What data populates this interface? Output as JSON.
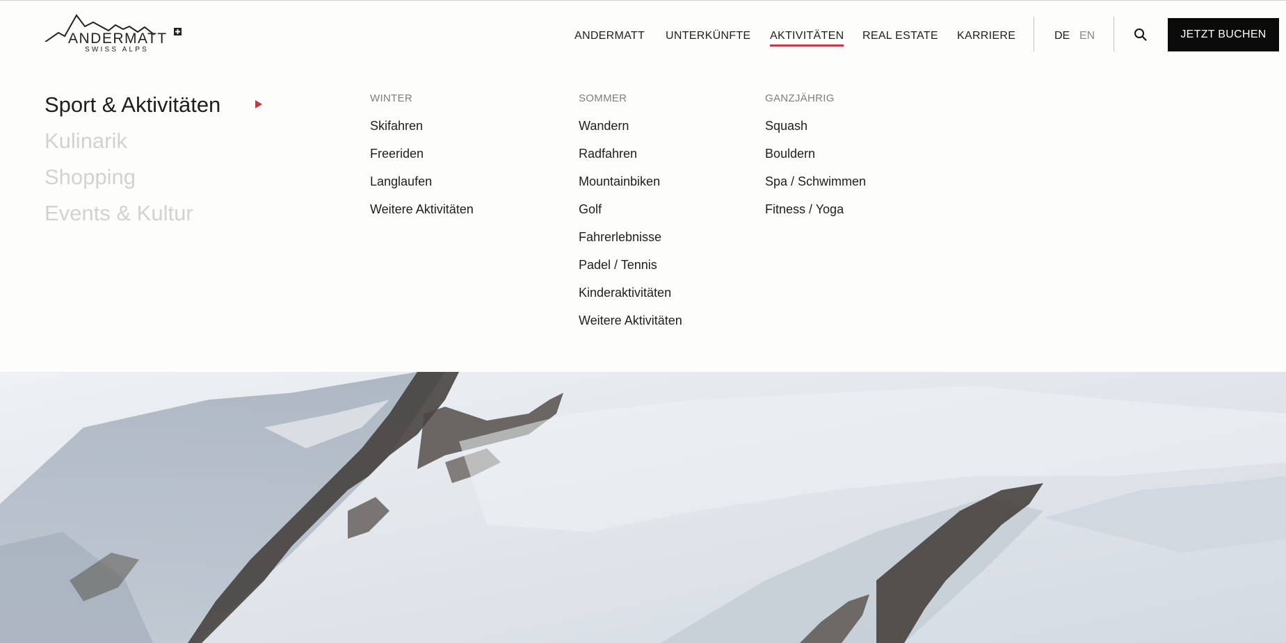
{
  "brand": {
    "name": "ANDERMATT",
    "subtitle": "SWISS ALPS"
  },
  "nav": {
    "items": [
      {
        "label": "ANDERMATT",
        "active": false
      },
      {
        "label": "UNTERKÜNFTE",
        "active": false
      },
      {
        "label": "AKTIVITÄTEN",
        "active": true
      },
      {
        "label": "REAL ESTATE",
        "active": false
      },
      {
        "label": "KARRIERE",
        "active": false
      }
    ],
    "accent_color": "#c8353b"
  },
  "languages": {
    "de": "DE",
    "en": "EN",
    "selected": "DE"
  },
  "search": {
    "icon": "search-icon"
  },
  "cta": {
    "label": "JETZT BUCHEN"
  },
  "megamenu": {
    "categories": [
      {
        "label": "Sport & Aktivitäten",
        "active": true
      },
      {
        "label": "Kulinarik",
        "active": false
      },
      {
        "label": "Shopping",
        "active": false
      },
      {
        "label": "Events & Kultur",
        "active": false
      }
    ],
    "columns": [
      {
        "heading": "WINTER",
        "items": [
          "Skifahren",
          "Freeriden",
          "Langlaufen",
          "Weitere Aktivitäten"
        ]
      },
      {
        "heading": "SOMMER",
        "items": [
          "Wandern",
          "Radfahren",
          "Mountainbiken",
          "Golf",
          "Fahrerlebnisse",
          "Padel / Tennis",
          "Kinderaktivitäten",
          "Weitere Aktivitäten"
        ]
      },
      {
        "heading": "GANZJÄHRIG",
        "items": [
          "Squash",
          "Bouldern",
          "Spa / Schwimmen",
          "Fitness / Yoga"
        ]
      }
    ]
  }
}
